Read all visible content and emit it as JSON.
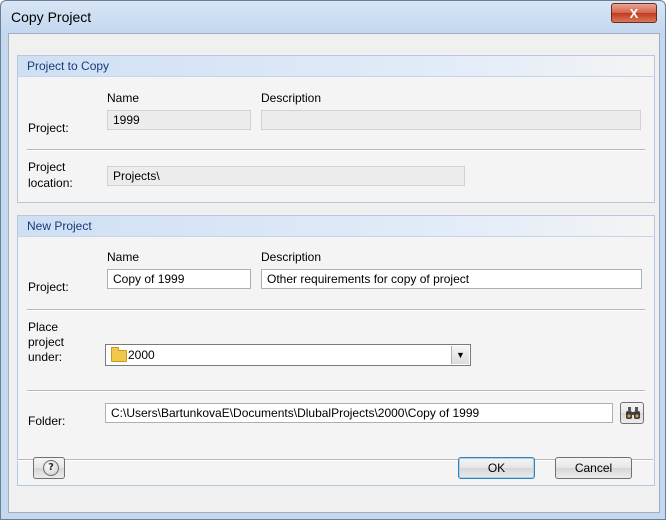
{
  "window": {
    "title": "Copy Project",
    "close_glyph": "X"
  },
  "project_to_copy": {
    "header": "Project to Copy",
    "name_col": "Name",
    "desc_col": "Description",
    "project_label": "Project:",
    "name_value": "1999",
    "desc_value": "",
    "location_label_1": "Project",
    "location_label_2": "location:",
    "location_value": "Projects\\"
  },
  "new_project": {
    "header": "New Project",
    "name_col": "Name",
    "desc_col": "Description",
    "project_label": "Project:",
    "name_value": "Copy of 1999",
    "desc_value": "Other requirements for copy of project",
    "place_label_1": "Place",
    "place_label_2": "project",
    "place_label_3": "under:",
    "place_value": "2000",
    "folder_label": "Folder:",
    "folder_value": "C:\\Users\\BartunkovaE\\Documents\\DlubalProjects\\2000\\Copy of 1999"
  },
  "buttons": {
    "ok": "OK",
    "cancel": "Cancel",
    "help_glyph": "?"
  },
  "icons": {
    "help": "help-icon",
    "browse": "binoculars-icon",
    "folder": "folder-icon",
    "dropdown": "chevron-down-icon"
  }
}
